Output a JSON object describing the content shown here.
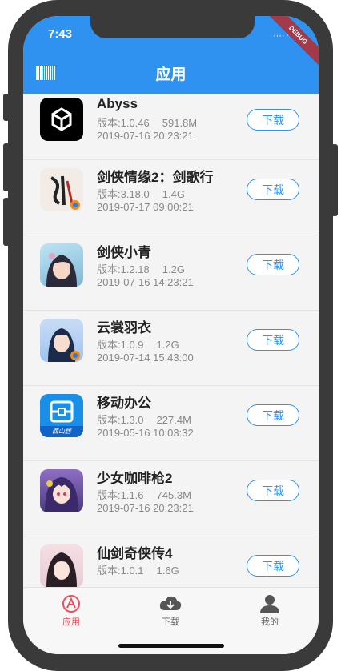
{
  "status_bar": {
    "time": "7:43",
    "debug_label": "DEBUG"
  },
  "app_bar": {
    "title": "应用",
    "left_icon": "barcode-icon"
  },
  "apps": [
    {
      "name": "Abyss",
      "version": "版本:1.0.46",
      "size": "591.8M",
      "date": "2019-07-16 20:23:21",
      "download_label": "下载",
      "icon": "unity-icon",
      "icon_color": "#000000"
    },
    {
      "name": "剑侠情缘2：剑歌行",
      "version": "版本:3.18.0",
      "size": "1.4G",
      "date": "2019-07-17 09:00:21",
      "download_label": "下载",
      "icon": "sword-calligraphy-icon",
      "icon_color": "#f3ece6"
    },
    {
      "name": "剑侠小青",
      "version": "版本:1.2.18",
      "size": "1.2G",
      "date": "2019-07-16 14:23:21",
      "download_label": "下载",
      "icon": "heroine-portrait-icon",
      "icon_color": "#7fb8d8"
    },
    {
      "name": "云裳羽衣",
      "version": "版本:1.0.9",
      "size": "1.2G",
      "date": "2019-07-14 15:43:00",
      "download_label": "下载",
      "icon": "fairy-portrait-icon",
      "icon_color": "#9fc3ef"
    },
    {
      "name": "移动办公",
      "version": "版本:1.3.0",
      "size": "227.4M",
      "date": "2019-05-16 10:03:32",
      "download_label": "下载",
      "icon": "office-app-icon",
      "icon_color": "#1a8fe8",
      "icon_caption": "西山居"
    },
    {
      "name": "少女咖啡枪2",
      "version": "版本:1.1.6",
      "size": "745.3M",
      "date": "2019-07-16 20:23:21",
      "download_label": "下载",
      "icon": "anime-girl-icon",
      "icon_color": "#6a4ea0"
    },
    {
      "name": "仙剑奇侠传4",
      "version": "版本:1.0.1",
      "size": "1.6G",
      "date": "",
      "download_label": "下载",
      "icon": "xianjian-portrait-icon",
      "icon_color": "#e7cdd4"
    }
  ],
  "bottom_nav": [
    {
      "label": "应用",
      "icon": "apps-icon",
      "active": true
    },
    {
      "label": "下载",
      "icon": "cloud-download-icon",
      "active": false
    },
    {
      "label": "我的",
      "icon": "person-icon",
      "active": false
    }
  ],
  "colors": {
    "primary": "#2f92f0",
    "active_tab": "#e8505b",
    "muted_text": "#888888"
  }
}
